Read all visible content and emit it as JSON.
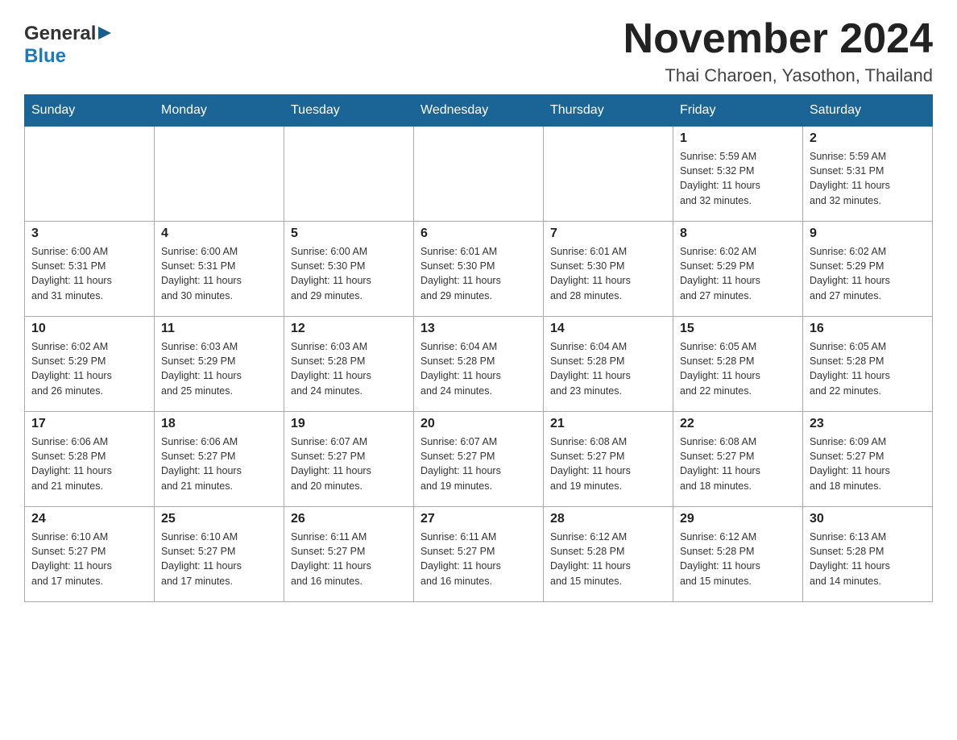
{
  "logo": {
    "text_general": "General",
    "text_blue": "Blue",
    "arrow": "▶"
  },
  "title": "November 2024",
  "subtitle": "Thai Charoen, Yasothon, Thailand",
  "days_of_week": [
    "Sunday",
    "Monday",
    "Tuesday",
    "Wednesday",
    "Thursday",
    "Friday",
    "Saturday"
  ],
  "weeks": [
    [
      {
        "day": "",
        "info": ""
      },
      {
        "day": "",
        "info": ""
      },
      {
        "day": "",
        "info": ""
      },
      {
        "day": "",
        "info": ""
      },
      {
        "day": "",
        "info": ""
      },
      {
        "day": "1",
        "info": "Sunrise: 5:59 AM\nSunset: 5:32 PM\nDaylight: 11 hours\nand 32 minutes."
      },
      {
        "day": "2",
        "info": "Sunrise: 5:59 AM\nSunset: 5:31 PM\nDaylight: 11 hours\nand 32 minutes."
      }
    ],
    [
      {
        "day": "3",
        "info": "Sunrise: 6:00 AM\nSunset: 5:31 PM\nDaylight: 11 hours\nand 31 minutes."
      },
      {
        "day": "4",
        "info": "Sunrise: 6:00 AM\nSunset: 5:31 PM\nDaylight: 11 hours\nand 30 minutes."
      },
      {
        "day": "5",
        "info": "Sunrise: 6:00 AM\nSunset: 5:30 PM\nDaylight: 11 hours\nand 29 minutes."
      },
      {
        "day": "6",
        "info": "Sunrise: 6:01 AM\nSunset: 5:30 PM\nDaylight: 11 hours\nand 29 minutes."
      },
      {
        "day": "7",
        "info": "Sunrise: 6:01 AM\nSunset: 5:30 PM\nDaylight: 11 hours\nand 28 minutes."
      },
      {
        "day": "8",
        "info": "Sunrise: 6:02 AM\nSunset: 5:29 PM\nDaylight: 11 hours\nand 27 minutes."
      },
      {
        "day": "9",
        "info": "Sunrise: 6:02 AM\nSunset: 5:29 PM\nDaylight: 11 hours\nand 27 minutes."
      }
    ],
    [
      {
        "day": "10",
        "info": "Sunrise: 6:02 AM\nSunset: 5:29 PM\nDaylight: 11 hours\nand 26 minutes."
      },
      {
        "day": "11",
        "info": "Sunrise: 6:03 AM\nSunset: 5:29 PM\nDaylight: 11 hours\nand 25 minutes."
      },
      {
        "day": "12",
        "info": "Sunrise: 6:03 AM\nSunset: 5:28 PM\nDaylight: 11 hours\nand 24 minutes."
      },
      {
        "day": "13",
        "info": "Sunrise: 6:04 AM\nSunset: 5:28 PM\nDaylight: 11 hours\nand 24 minutes."
      },
      {
        "day": "14",
        "info": "Sunrise: 6:04 AM\nSunset: 5:28 PM\nDaylight: 11 hours\nand 23 minutes."
      },
      {
        "day": "15",
        "info": "Sunrise: 6:05 AM\nSunset: 5:28 PM\nDaylight: 11 hours\nand 22 minutes."
      },
      {
        "day": "16",
        "info": "Sunrise: 6:05 AM\nSunset: 5:28 PM\nDaylight: 11 hours\nand 22 minutes."
      }
    ],
    [
      {
        "day": "17",
        "info": "Sunrise: 6:06 AM\nSunset: 5:28 PM\nDaylight: 11 hours\nand 21 minutes."
      },
      {
        "day": "18",
        "info": "Sunrise: 6:06 AM\nSunset: 5:27 PM\nDaylight: 11 hours\nand 21 minutes."
      },
      {
        "day": "19",
        "info": "Sunrise: 6:07 AM\nSunset: 5:27 PM\nDaylight: 11 hours\nand 20 minutes."
      },
      {
        "day": "20",
        "info": "Sunrise: 6:07 AM\nSunset: 5:27 PM\nDaylight: 11 hours\nand 19 minutes."
      },
      {
        "day": "21",
        "info": "Sunrise: 6:08 AM\nSunset: 5:27 PM\nDaylight: 11 hours\nand 19 minutes."
      },
      {
        "day": "22",
        "info": "Sunrise: 6:08 AM\nSunset: 5:27 PM\nDaylight: 11 hours\nand 18 minutes."
      },
      {
        "day": "23",
        "info": "Sunrise: 6:09 AM\nSunset: 5:27 PM\nDaylight: 11 hours\nand 18 minutes."
      }
    ],
    [
      {
        "day": "24",
        "info": "Sunrise: 6:10 AM\nSunset: 5:27 PM\nDaylight: 11 hours\nand 17 minutes."
      },
      {
        "day": "25",
        "info": "Sunrise: 6:10 AM\nSunset: 5:27 PM\nDaylight: 11 hours\nand 17 minutes."
      },
      {
        "day": "26",
        "info": "Sunrise: 6:11 AM\nSunset: 5:27 PM\nDaylight: 11 hours\nand 16 minutes."
      },
      {
        "day": "27",
        "info": "Sunrise: 6:11 AM\nSunset: 5:27 PM\nDaylight: 11 hours\nand 16 minutes."
      },
      {
        "day": "28",
        "info": "Sunrise: 6:12 AM\nSunset: 5:28 PM\nDaylight: 11 hours\nand 15 minutes."
      },
      {
        "day": "29",
        "info": "Sunrise: 6:12 AM\nSunset: 5:28 PM\nDaylight: 11 hours\nand 15 minutes."
      },
      {
        "day": "30",
        "info": "Sunrise: 6:13 AM\nSunset: 5:28 PM\nDaylight: 11 hours\nand 14 minutes."
      }
    ]
  ]
}
